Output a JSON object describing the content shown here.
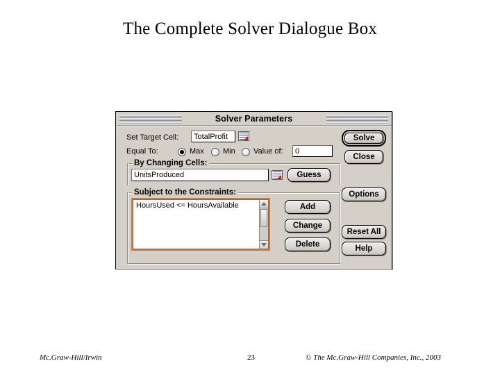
{
  "slide": {
    "title": "The Complete Solver Dialogue Box"
  },
  "dialog": {
    "title": "Solver Parameters",
    "target_cell": {
      "label": "Set Target Cell:",
      "value": "TotalProfit",
      "picker_icon": "range-select-icon"
    },
    "equal_to": {
      "label": "Equal To:",
      "options": [
        "Max",
        "Min",
        "Value of:"
      ],
      "selected": "Max",
      "value_of_input": "0"
    },
    "changing_cells": {
      "group_label": "By Changing Cells:",
      "value": "UnitsProduced",
      "picker_icon": "range-select-icon",
      "guess_label": "Guess"
    },
    "constraints": {
      "group_label": "Subject to the Constraints:",
      "items": [
        "HoursUsed <= HoursAvailable"
      ],
      "add_label": "Add",
      "change_label": "Change",
      "delete_label": "Delete",
      "scroll_up_icon": "triangle-up-icon",
      "scroll_down_icon": "triangle-down-icon",
      "focus_color": "#d2783c"
    },
    "actions": {
      "solve_label": "Solve",
      "close_label": "Close",
      "options_label": "Options",
      "reset_all_label": "Reset All",
      "help_label": "Help"
    }
  },
  "footer": {
    "left": "Mc.Graw-Hill/Irwin",
    "page": "23",
    "right": "© The Mc.Graw-Hill Companies, Inc., 2003"
  }
}
